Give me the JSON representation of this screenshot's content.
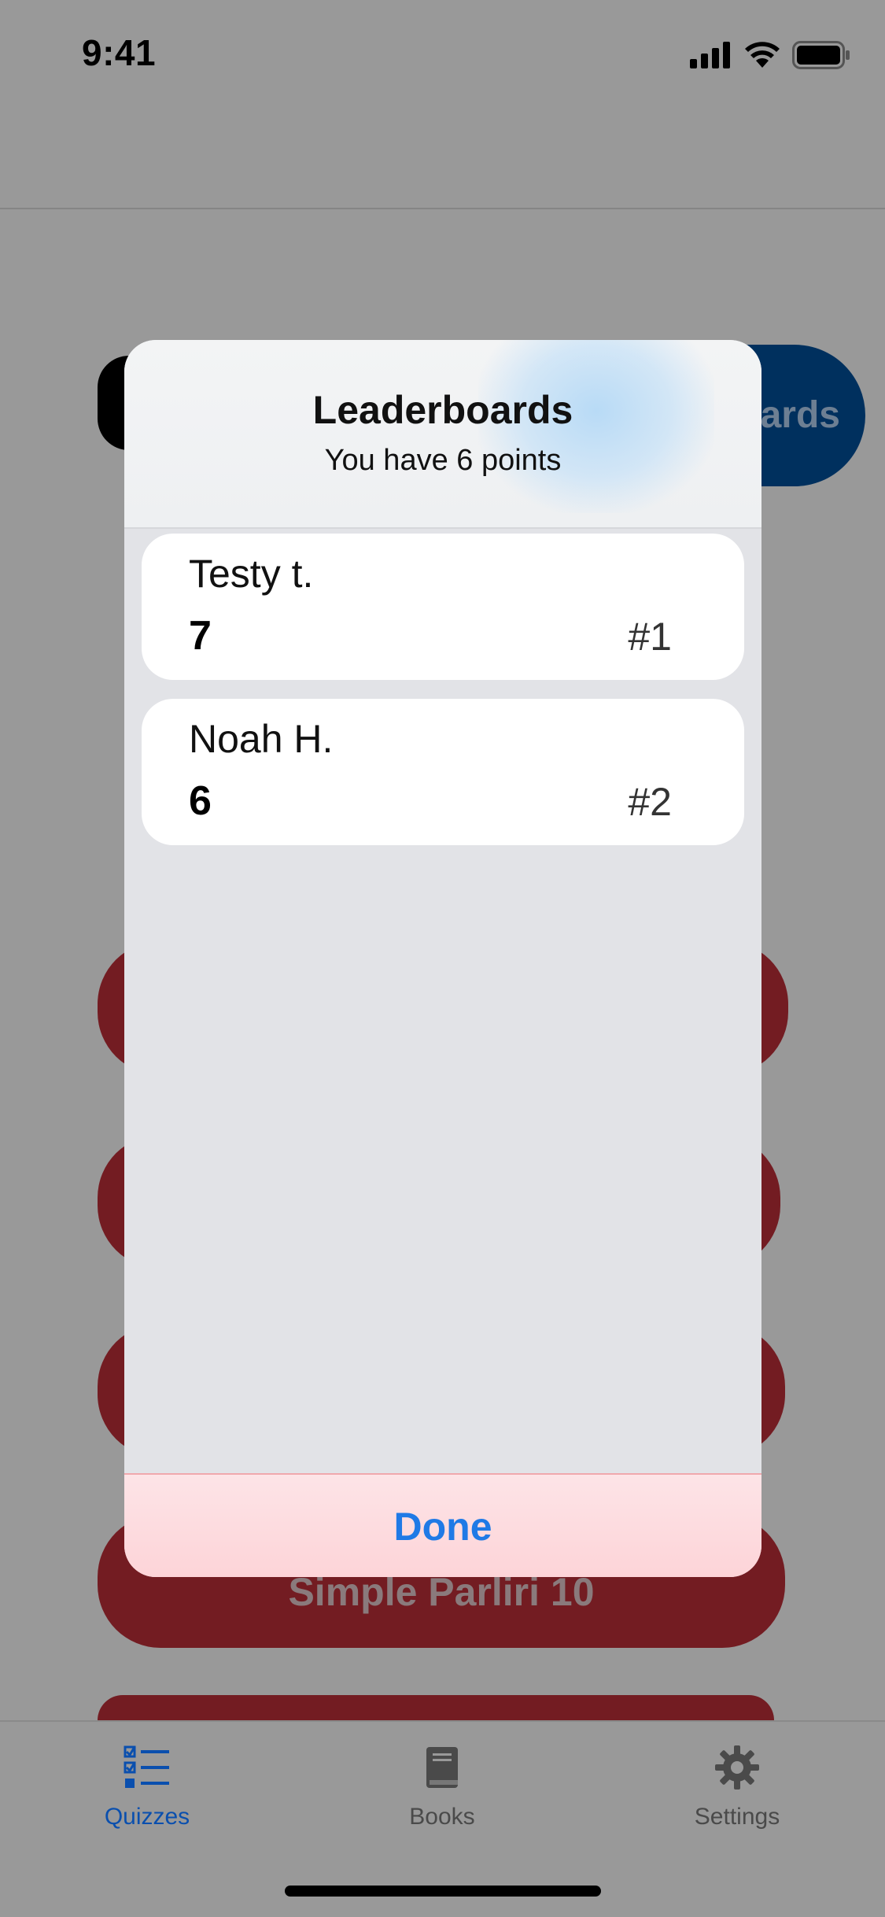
{
  "status_bar": {
    "time": "9:41"
  },
  "background": {
    "leaderboard_button_label": "ards",
    "quiz_label": "Simple Parliri 10"
  },
  "modal": {
    "title": "Leaderboards",
    "subtitle": "You have 6 points",
    "rows": [
      {
        "name": "Testy t.",
        "score": "7",
        "rank": "#1"
      },
      {
        "name": "Noah H.",
        "score": "6",
        "rank": "#2"
      }
    ],
    "done_label": "Done"
  },
  "tabs": [
    {
      "label": "Quizzes",
      "icon": "checklist-icon",
      "active": true
    },
    {
      "label": "Books",
      "icon": "book-icon",
      "active": false
    },
    {
      "label": "Settings",
      "icon": "gear-icon",
      "active": false
    }
  ],
  "colors": {
    "accent": "#1f7ae6",
    "tab_active": "#0a4fae",
    "tab_inactive": "#4a4a4a",
    "card_dim": "#731c22",
    "leaderboard_button_dim": "#00305e"
  }
}
